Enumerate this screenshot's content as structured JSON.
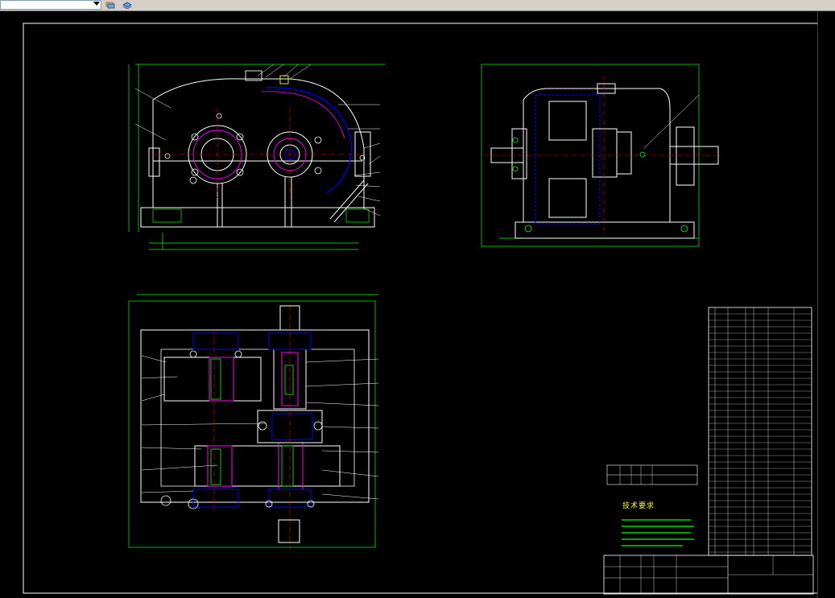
{
  "window": {
    "toolbar": {
      "combo_value": "",
      "buttons": [
        {
          "name": "layer-icon"
        },
        {
          "name": "layer-stack-icon"
        }
      ]
    }
  },
  "drawing": {
    "tech_requirements_title": "技术要求",
    "status_text": "",
    "colors": {
      "outline": "#ffffff",
      "frame": "#00ff00",
      "gear": "#ff00ff",
      "hidden": "#0000ff",
      "center": "#ff0000",
      "leader": "#ffff00",
      "dim_text": "#00ff00"
    }
  }
}
